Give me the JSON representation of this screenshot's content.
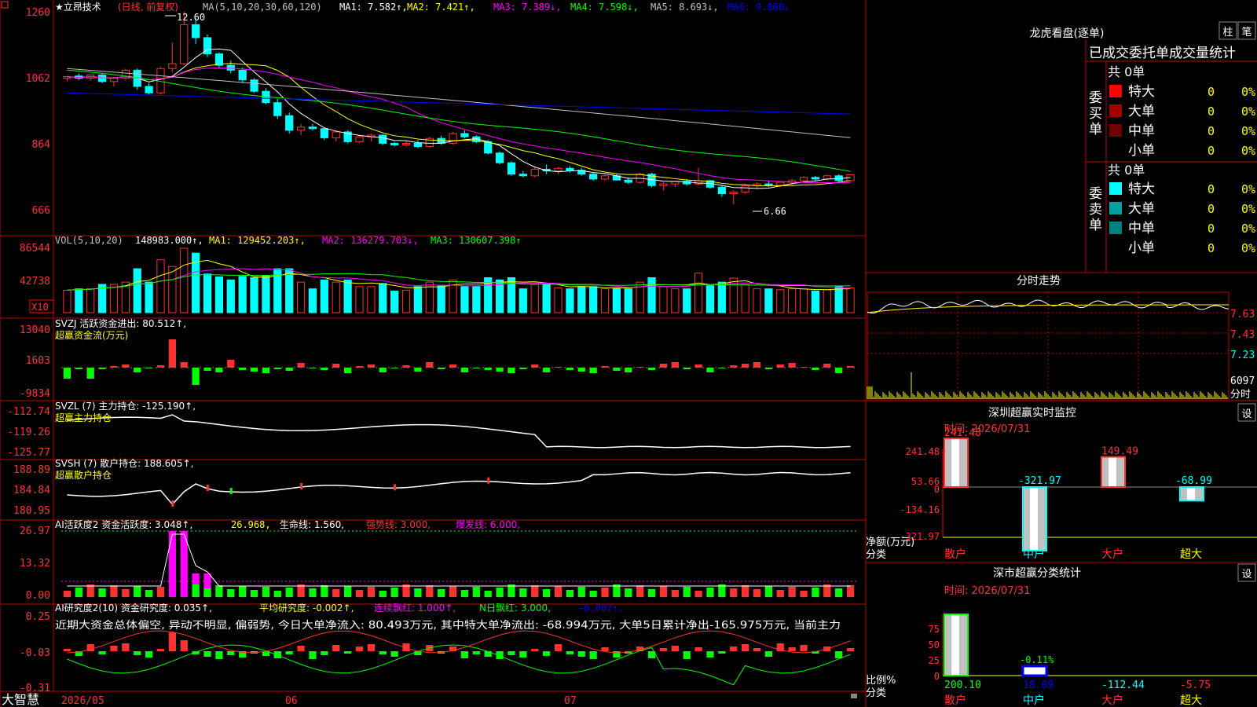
{
  "app": {
    "name": "大智慧",
    "date_start": "2026/05",
    "month_06": "06",
    "month_07": "07"
  },
  "colors": {
    "up": "#ff3232",
    "down": "#00ffff",
    "bg": "#000000",
    "grid": "#ff0000",
    "ma1": "#ffffff",
    "ma2": "#ffff00",
    "ma3": "#ff00ff",
    "ma4": "#00ff00",
    "ma5": "#c0c0c0",
    "ma6": "#0000ff"
  },
  "price_panel": {
    "stock_name": "★立昂技术",
    "period": "(日线, 前复权)",
    "ma_params": "MA(5,10,20,30,60,120)",
    "ma1": "MA1: 7.582↑,",
    "ma2": "MA2: 7.421↑,",
    "ma3": "MA3: 7.389↓,",
    "ma4": "MA4: 7.598↓,",
    "ma5": "MA5: 8.693↓,",
    "ma6": "MA6: 9.860↓",
    "high_label": "12.60",
    "low_label": "6.66",
    "y_ticks": [
      "1260",
      "1062",
      "864",
      "666"
    ],
    "ylim": [
      5.8,
      12.6
    ]
  },
  "vol_panel": {
    "title": "VOL(5,10,20)",
    "value": "148983.000↑,",
    "ma1": "MA1: 129452.203↑,",
    "ma2": "MA2: 136279.703↓,",
    "ma3": "MA3: 130607.398↑",
    "y_ticks": [
      "86544",
      "42738"
    ],
    "unit": "X10"
  },
  "svzj_panel": {
    "title": "SVZJ  活跃资金进出: 80.512↑,",
    "subtitle": "超赢资金流(万元)",
    "y_ticks": [
      "13040",
      "1603",
      "-9834"
    ]
  },
  "svzl_panel": {
    "title": "SVZL (7) 主力持仓: -125.190↑,",
    "subtitle": "超赢主力持仓",
    "y_ticks": [
      "-112.74",
      "-119.26",
      "-125.77"
    ]
  },
  "svsh_panel": {
    "title": "SVSH (7) 散户持仓: 188.605↑,",
    "subtitle": "超赢散户持仓",
    "y_ticks": [
      "188.89",
      "184.84",
      "180.95"
    ]
  },
  "ai_panel": {
    "title": "AI活跃度2 资金活跃度: 3.048↑,",
    "v2": "26.968,",
    "v3": "生命线: 1.560,",
    "v4": "强势线: 3.000,",
    "v5": "爆发线: 6.000,",
    "y_ticks": [
      "26.97",
      "13.32",
      "0.00"
    ]
  },
  "research_panel": {
    "title": "AI研究度2(10) 资金研究度: 0.035↑,",
    "v2": "平均研究度: -0.002↑,",
    "v3": "连续飘红: 1.000↑,",
    "v4": "N日飘红: 3.000,",
    "v5": "-0.002↑,",
    "text": "近期大资金总体偏空, 异动不明显, 偏弱势, 今日大单净流入: 80.493万元, 其中特大单净流出: -68.994万元, 大单5日累计净出-165.975万元, 当前主力",
    "y_ticks": [
      "0.25",
      "-0.03",
      "-0.31"
    ]
  },
  "right": {
    "dragon_title": "龙虎看盘(逐单)",
    "btn_column": "柱",
    "btn_order": "笔",
    "stats_title": "已成交委托单成交量统计",
    "buy_label": "委买单",
    "sell_label": "委卖单",
    "buy_total": "共 0单",
    "sell_total": "共 0单",
    "buy_rows": [
      {
        "name": "特大",
        "count": "0",
        "pct": "0%",
        "color": "#ff0000"
      },
      {
        "name": "大单",
        "count": "0",
        "pct": "0%",
        "color": "#a00000"
      },
      {
        "name": "中单",
        "count": "0",
        "pct": "0%",
        "color": "#700000"
      },
      {
        "name": "小单",
        "count": "0",
        "pct": "0%",
        "color": "#000000"
      }
    ],
    "sell_rows": [
      {
        "name": "特大",
        "count": "0",
        "pct": "0%",
        "color": "#00ffff"
      },
      {
        "name": "大单",
        "count": "0",
        "pct": "0%",
        "color": "#00a0a0"
      },
      {
        "name": "中单",
        "count": "0",
        "pct": "0%",
        "color": "#008080"
      },
      {
        "name": "小单",
        "count": "0",
        "pct": "0%",
        "color": "#000000"
      }
    ],
    "intraday_title": "分时走势",
    "intraday_ticks": [
      "7.63",
      "7.43",
      "7.23"
    ],
    "intraday_vol": "6097",
    "intraday_unit": "分时",
    "monitor_title": "深圳超赢实时监控",
    "settings_label": "设",
    "monitor_time": "时间: 2026/07/31",
    "monitor_ticks": [
      "241.48",
      "53.66",
      "0",
      "-134.16",
      "-321.97"
    ],
    "monitor_ylabel": "净额(万元)",
    "monitor_xlabel": "分类",
    "monitor_bars": [
      {
        "name": "散户",
        "value": 241.48,
        "label": "241.48"
      },
      {
        "name": "中户",
        "value": -321.97,
        "label": "-321.97"
      },
      {
        "name": "大户",
        "value": 149.49,
        "label": "149.49"
      },
      {
        "name": "超大",
        "value": -68.99,
        "label": "-68.99"
      }
    ],
    "class_title": "深市超赢分类统计",
    "class_time": "时间: 2026/07/31",
    "class_ticks": [
      "75",
      "50",
      "25",
      "0"
    ],
    "class_ylabel": "比例%",
    "class_xlabel": "分类",
    "class_pct_label": "-0.11%",
    "class_bars": [
      {
        "name": "散户",
        "value": "200.10",
        "pct": 100
      },
      {
        "name": "中户",
        "value": "18.09",
        "pct": 16
      },
      {
        "name": "大户",
        "value": "-112.44",
        "pct": 0
      },
      {
        "name": "超大",
        "value": "-5.75",
        "pct": 0
      }
    ]
  },
  "chart_data": {
    "type": "candlestick",
    "x_start": "2026/05",
    "candles": [
      [
        10.55,
        10.62,
        10.45,
        10.6
      ],
      [
        10.62,
        10.7,
        10.5,
        10.55
      ],
      [
        10.55,
        10.68,
        10.48,
        10.65
      ],
      [
        10.65,
        10.7,
        10.4,
        10.45
      ],
      [
        10.45,
        10.6,
        10.3,
        10.55
      ],
      [
        10.55,
        10.85,
        10.5,
        10.8
      ],
      [
        10.8,
        10.85,
        10.2,
        10.3
      ],
      [
        10.3,
        10.4,
        10.05,
        10.1
      ],
      [
        10.1,
        10.9,
        10.05,
        10.85
      ],
      [
        10.85,
        11.65,
        10.75,
        11.0
      ],
      [
        11.0,
        12.6,
        10.95,
        12.2
      ],
      [
        12.2,
        12.4,
        11.6,
        11.8
      ],
      [
        11.8,
        11.9,
        11.2,
        11.3
      ],
      [
        11.3,
        11.35,
        10.85,
        10.95
      ],
      [
        10.95,
        11.1,
        10.7,
        10.8
      ],
      [
        10.8,
        10.88,
        10.4,
        10.5
      ],
      [
        10.5,
        10.55,
        10.1,
        10.15
      ],
      [
        10.15,
        10.25,
        9.75,
        9.8
      ],
      [
        9.8,
        9.95,
        9.3,
        9.4
      ],
      [
        9.4,
        9.5,
        8.85,
        8.95
      ],
      [
        8.95,
        9.15,
        8.8,
        9.05
      ],
      [
        9.05,
        9.15,
        8.95,
        9.0
      ],
      [
        9.0,
        9.05,
        8.65,
        8.72
      ],
      [
        8.72,
        8.95,
        8.6,
        8.9
      ],
      [
        8.9,
        8.95,
        8.55,
        8.6
      ],
      [
        8.6,
        8.8,
        8.55,
        8.75
      ],
      [
        8.75,
        8.85,
        8.6,
        8.8
      ],
      [
        8.8,
        8.82,
        8.5,
        8.55
      ],
      [
        8.55,
        8.6,
        8.45,
        8.5
      ],
      [
        8.5,
        8.62,
        8.45,
        8.55
      ],
      [
        8.55,
        8.65,
        8.4,
        8.45
      ],
      [
        8.45,
        8.75,
        8.4,
        8.7
      ],
      [
        8.7,
        8.78,
        8.5,
        8.55
      ],
      [
        8.55,
        8.9,
        8.5,
        8.85
      ],
      [
        8.85,
        8.95,
        8.7,
        8.75
      ],
      [
        8.75,
        8.8,
        8.55,
        8.6
      ],
      [
        8.6,
        8.65,
        8.2,
        8.25
      ],
      [
        8.25,
        8.3,
        7.9,
        7.95
      ],
      [
        7.95,
        8.0,
        7.55,
        7.6
      ],
      [
        7.6,
        7.7,
        7.5,
        7.55
      ],
      [
        7.55,
        7.8,
        7.5,
        7.75
      ],
      [
        7.75,
        7.9,
        7.6,
        7.7
      ],
      [
        7.7,
        7.82,
        7.6,
        7.78
      ],
      [
        7.78,
        7.85,
        7.65,
        7.72
      ],
      [
        7.72,
        7.8,
        7.55,
        7.6
      ],
      [
        7.6,
        7.65,
        7.4,
        7.45
      ],
      [
        7.45,
        7.6,
        7.4,
        7.55
      ],
      [
        7.55,
        7.62,
        7.4,
        7.42
      ],
      [
        7.42,
        7.5,
        7.3,
        7.35
      ],
      [
        7.35,
        7.65,
        7.3,
        7.6
      ],
      [
        7.6,
        7.65,
        7.2,
        7.25
      ],
      [
        7.25,
        7.35,
        7.1,
        7.3
      ],
      [
        7.3,
        7.4,
        7.2,
        7.38
      ],
      [
        7.38,
        7.45,
        7.25,
        7.3
      ],
      [
        7.3,
        7.8,
        7.25,
        7.4
      ],
      [
        7.4,
        7.42,
        7.15,
        7.2
      ],
      [
        7.2,
        7.25,
        6.9,
        7.0
      ],
      [
        7.0,
        7.1,
        6.66,
        7.05
      ],
      [
        7.05,
        7.3,
        7.0,
        7.25
      ],
      [
        7.25,
        7.35,
        7.15,
        7.3
      ],
      [
        7.3,
        7.4,
        7.2,
        7.25
      ],
      [
        7.25,
        7.38,
        7.2,
        7.35
      ],
      [
        7.35,
        7.45,
        7.25,
        7.4
      ],
      [
        7.4,
        7.55,
        7.35,
        7.5
      ],
      [
        7.5,
        7.55,
        7.4,
        7.45
      ],
      [
        7.45,
        7.58,
        7.4,
        7.55
      ],
      [
        7.55,
        7.6,
        7.35,
        7.4
      ],
      [
        7.4,
        7.6,
        7.38,
        7.58
      ]
    ]
  }
}
